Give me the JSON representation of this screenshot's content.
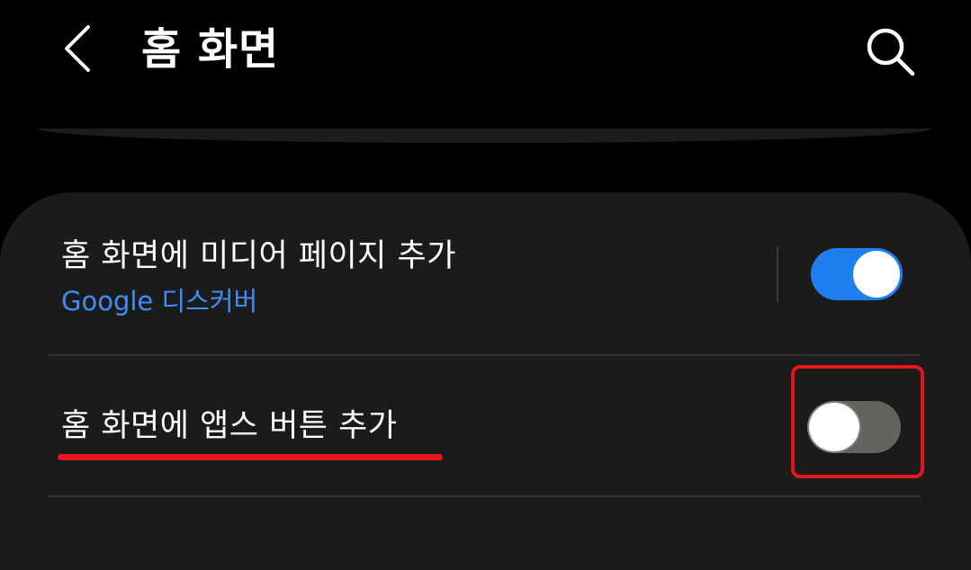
{
  "header": {
    "title": "홈 화면",
    "back_icon": "chevron-left-icon",
    "search_icon": "search-icon"
  },
  "settings": {
    "media_page": {
      "title": "홈 화면에 미디어 페이지 추가",
      "subtitle": "Google 디스커버",
      "enabled": true
    },
    "apps_button": {
      "title": "홈 화면에 앱스 버튼 추가",
      "enabled": false
    }
  },
  "colors": {
    "background": "#000000",
    "card": "#1b1b1b",
    "accent_blue": "#1f7ff0",
    "subtitle_blue": "#3e8ef7",
    "toggle_off": "#64645f",
    "annotation_red": "#e3161e"
  }
}
